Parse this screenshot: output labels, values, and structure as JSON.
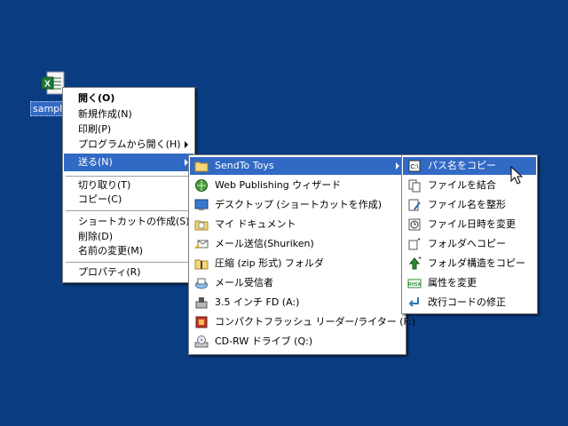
{
  "desktop": {
    "icon_label": "sample"
  },
  "context_menu": {
    "items": [
      {
        "label": "開く(O)"
      },
      {
        "label": "新規作成(N)"
      },
      {
        "label": "印刷(P)"
      },
      {
        "label": "プログラムから開く(H)"
      },
      {
        "label": "送る(N)"
      },
      {
        "label": "切り取り(T)"
      },
      {
        "label": "コピー(C)"
      },
      {
        "label": "ショートカットの作成(S)"
      },
      {
        "label": "削除(D)"
      },
      {
        "label": "名前の変更(M)"
      },
      {
        "label": "プロパティ(R)"
      }
    ]
  },
  "sendto_menu": {
    "items": [
      {
        "label": "SendTo Toys",
        "icon": "folder-icon"
      },
      {
        "label": "Web Publishing ウィザード",
        "icon": "web-publishing-icon"
      },
      {
        "label": "デスクトップ (ショートカットを作成)",
        "icon": "desktop-icon"
      },
      {
        "label": "マイ ドキュメント",
        "icon": "my-documents-icon"
      },
      {
        "label": "メール送信(Shuriken)",
        "icon": "mail-send-icon"
      },
      {
        "label": "圧縮 (zip 形式) フォルダ",
        "icon": "zip-folder-icon"
      },
      {
        "label": "メール受信者",
        "icon": "mail-recipient-icon"
      },
      {
        "label": "3.5 インチ FD (A:)",
        "icon": "floppy-icon"
      },
      {
        "label": "コンパクトフラッシュ リーダー/ライター (F:)",
        "icon": "compactflash-icon"
      },
      {
        "label": "CD-RW ドライブ (Q:)",
        "icon": "cd-drive-icon"
      }
    ]
  },
  "toys_menu": {
    "items": [
      {
        "label": "パス名をコピー",
        "icon": "copy-path-icon"
      },
      {
        "label": "ファイルを結合",
        "icon": "join-files-icon"
      },
      {
        "label": "ファイル名を整形",
        "icon": "format-filename-icon"
      },
      {
        "label": "ファイル日時を変更",
        "icon": "change-timestamp-icon"
      },
      {
        "label": "フォルダへコピー",
        "icon": "copy-to-folder-icon"
      },
      {
        "label": "フォルダ構造をコピー",
        "icon": "copy-folder-structure-icon"
      },
      {
        "label": "属性を変更",
        "icon": "change-attributes-icon"
      },
      {
        "label": "改行コードの修正",
        "icon": "fix-newline-icon"
      }
    ]
  }
}
